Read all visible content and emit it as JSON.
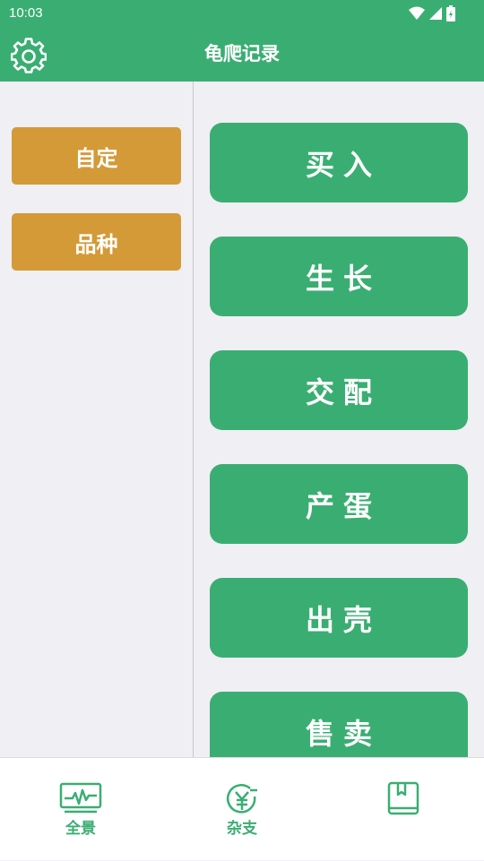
{
  "status": {
    "time": "10:03"
  },
  "appbar": {
    "title": "龟爬记录",
    "settings_icon": "gear-icon"
  },
  "sidebar": {
    "items": [
      {
        "label": "自定"
      },
      {
        "label": "品种"
      }
    ]
  },
  "main": {
    "buttons": [
      {
        "label": "买入"
      },
      {
        "label": "生长"
      },
      {
        "label": "交配"
      },
      {
        "label": "产蛋"
      },
      {
        "label": "出壳"
      },
      {
        "label": "售卖"
      }
    ]
  },
  "bottomnav": {
    "items": [
      {
        "label": "全景",
        "icon": "monitor-chart-icon"
      },
      {
        "label": "杂支",
        "icon": "yuan-coin-icon"
      },
      {
        "label": "",
        "icon": "book-icon"
      }
    ]
  },
  "colors": {
    "primary": "#3aae72",
    "accent": "#d49a37",
    "background": "#efeff4"
  }
}
